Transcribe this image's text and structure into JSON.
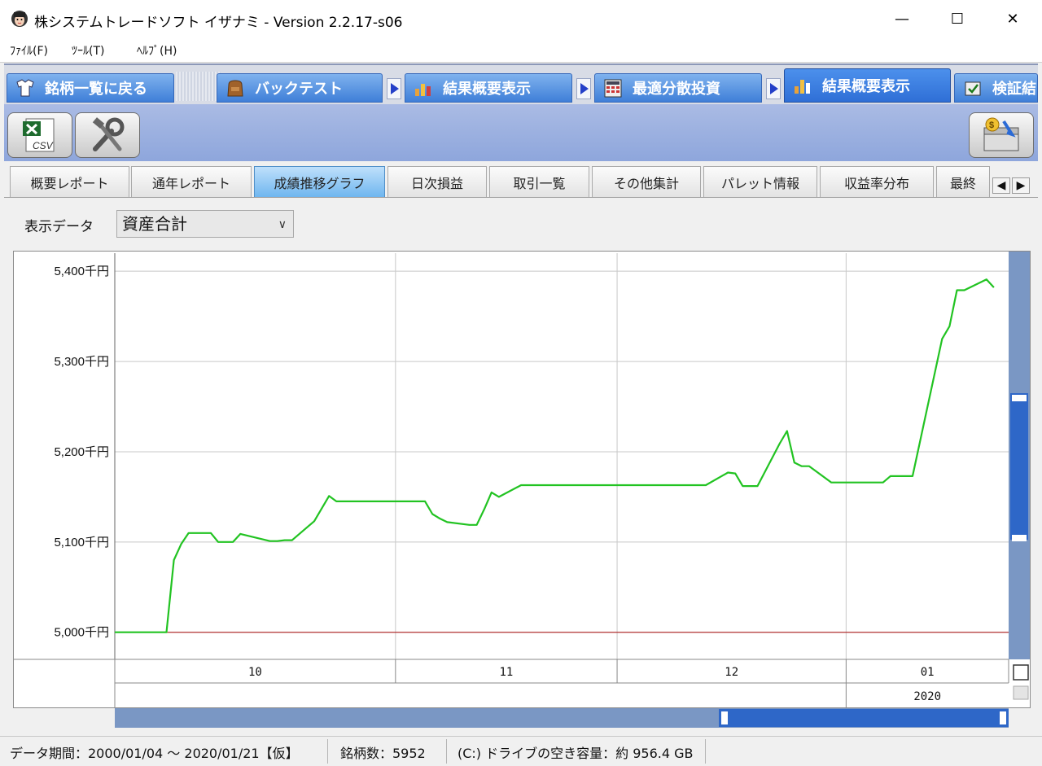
{
  "window": {
    "title": "株システムトレードソフト イザナミ - Version 2.2.17-s06",
    "minimize": "—",
    "maximize": "☐",
    "close": "✕"
  },
  "menu": [
    {
      "label": "ﾌｧｲﾙ(F)"
    },
    {
      "label": "ﾂｰﾙ(T)"
    },
    {
      "label": "ﾍﾙﾌﾟ(H)"
    }
  ],
  "nav": {
    "tabs": [
      {
        "label": "銘柄一覧に戻る",
        "icon": "shirt-icon"
      },
      {
        "label": "バックテスト",
        "icon": "bag-icon"
      },
      {
        "label": "結果概要表示",
        "icon": "bar-chart-icon"
      },
      {
        "label": "最適分散投資",
        "icon": "calculator-icon"
      },
      {
        "label": "結果概要表示",
        "icon": "bar-chart-icon",
        "active": true
      },
      {
        "label": "検証結",
        "icon": "verify-icon"
      }
    ]
  },
  "toolbar": {
    "csv_label": "CSV",
    "csv_icon": "csv-export-icon",
    "tools_icon": "tools-icon",
    "money_icon": "money-chest-icon"
  },
  "subtabs": {
    "items": [
      {
        "label": "概要レポート"
      },
      {
        "label": "通年レポート"
      },
      {
        "label": "成績推移グラフ",
        "active": true
      },
      {
        "label": "日次損益"
      },
      {
        "label": "取引一覧"
      },
      {
        "label": "その他集計"
      },
      {
        "label": "パレット情報"
      },
      {
        "label": "収益率分布"
      },
      {
        "label": "最終"
      }
    ],
    "left_arrow": "◀",
    "right_arrow": "▶"
  },
  "display": {
    "label": "表示データ",
    "selected": "資産合計"
  },
  "chart_data": {
    "type": "line",
    "y_tick_labels": [
      "5,400千円",
      "5,300千円",
      "5,200千円",
      "5,100千円",
      "5,000千円"
    ],
    "y_ticks": [
      5400,
      5300,
      5200,
      5100,
      5000
    ],
    "ylim": [
      4970,
      5420
    ],
    "x_month_labels": [
      "10",
      "11",
      "12",
      "01"
    ],
    "x_year_label": "2020",
    "baseline": 5000,
    "line_color": "#22c322",
    "baseline_color": "#b03030",
    "grid": true,
    "series": [
      {
        "x": [
          "2019-09-24",
          "2019-09-28",
          "2019-09-30",
          "2019-10-01",
          "2019-10-02",
          "2019-10-03",
          "2019-10-04",
          "2019-10-07",
          "2019-10-08",
          "2019-10-09",
          "2019-10-10",
          "2019-10-11",
          "2019-10-15",
          "2019-10-16",
          "2019-10-17",
          "2019-10-18",
          "2019-10-21",
          "2019-10-23",
          "2019-10-24",
          "2019-10-25",
          "2019-10-28",
          "2019-10-29",
          "2019-10-30",
          "2019-10-31",
          "2019-11-01",
          "2019-11-05",
          "2019-11-06",
          "2019-11-07",
          "2019-11-08",
          "2019-11-11",
          "2019-11-12",
          "2019-11-13",
          "2019-11-14",
          "2019-11-15",
          "2019-11-18",
          "2019-11-19",
          "2019-11-20",
          "2019-11-21",
          "2019-11-22",
          "2019-11-25",
          "2019-11-26",
          "2019-11-27",
          "2019-11-28",
          "2019-11-29",
          "2019-12-02",
          "2019-12-03",
          "2019-12-04",
          "2019-12-05",
          "2019-12-06",
          "2019-12-09",
          "2019-12-10",
          "2019-12-11",
          "2019-12-12",
          "2019-12-13",
          "2019-12-16",
          "2019-12-17",
          "2019-12-18",
          "2019-12-19",
          "2019-12-20",
          "2019-12-23",
          "2019-12-24",
          "2019-12-25",
          "2019-12-26",
          "2019-12-27",
          "2019-12-30",
          "2020-01-06",
          "2020-01-07",
          "2020-01-08",
          "2020-01-09",
          "2020-01-10",
          "2020-01-14",
          "2020-01-15",
          "2020-01-16",
          "2020-01-17",
          "2020-01-20",
          "2020-01-21"
        ],
        "values": [
          5000,
          5000,
          5000,
          5000,
          5080,
          5098,
          5110,
          5110,
          5100,
          5100,
          5100,
          5109,
          5101,
          5101,
          5102,
          5102,
          5123,
          5151,
          5145,
          5145,
          5145,
          5145,
          5145,
          5145,
          5145,
          5145,
          5131,
          5126,
          5122,
          5119,
          5119,
          5136,
          5155,
          5150,
          5163,
          5163,
          5163,
          5163,
          5163,
          5163,
          5163,
          5163,
          5163,
          5163,
          5163,
          5163,
          5163,
          5163,
          5163,
          5163,
          5163,
          5163,
          5163,
          5163,
          5177,
          5176,
          5162,
          5162,
          5162,
          5209,
          5223,
          5188,
          5184,
          5184,
          5166,
          5166,
          5173,
          5173,
          5173,
          5173,
          5325,
          5339,
          5379,
          5379,
          5391,
          5382
        ]
      }
    ]
  },
  "status": {
    "period": "データ期間：2000/01/04 ～ 2020/01/21【仮】",
    "symbols": "銘柄数：5952",
    "disk": "(C:) ドライブの空き容量：約 956.4 GB"
  }
}
